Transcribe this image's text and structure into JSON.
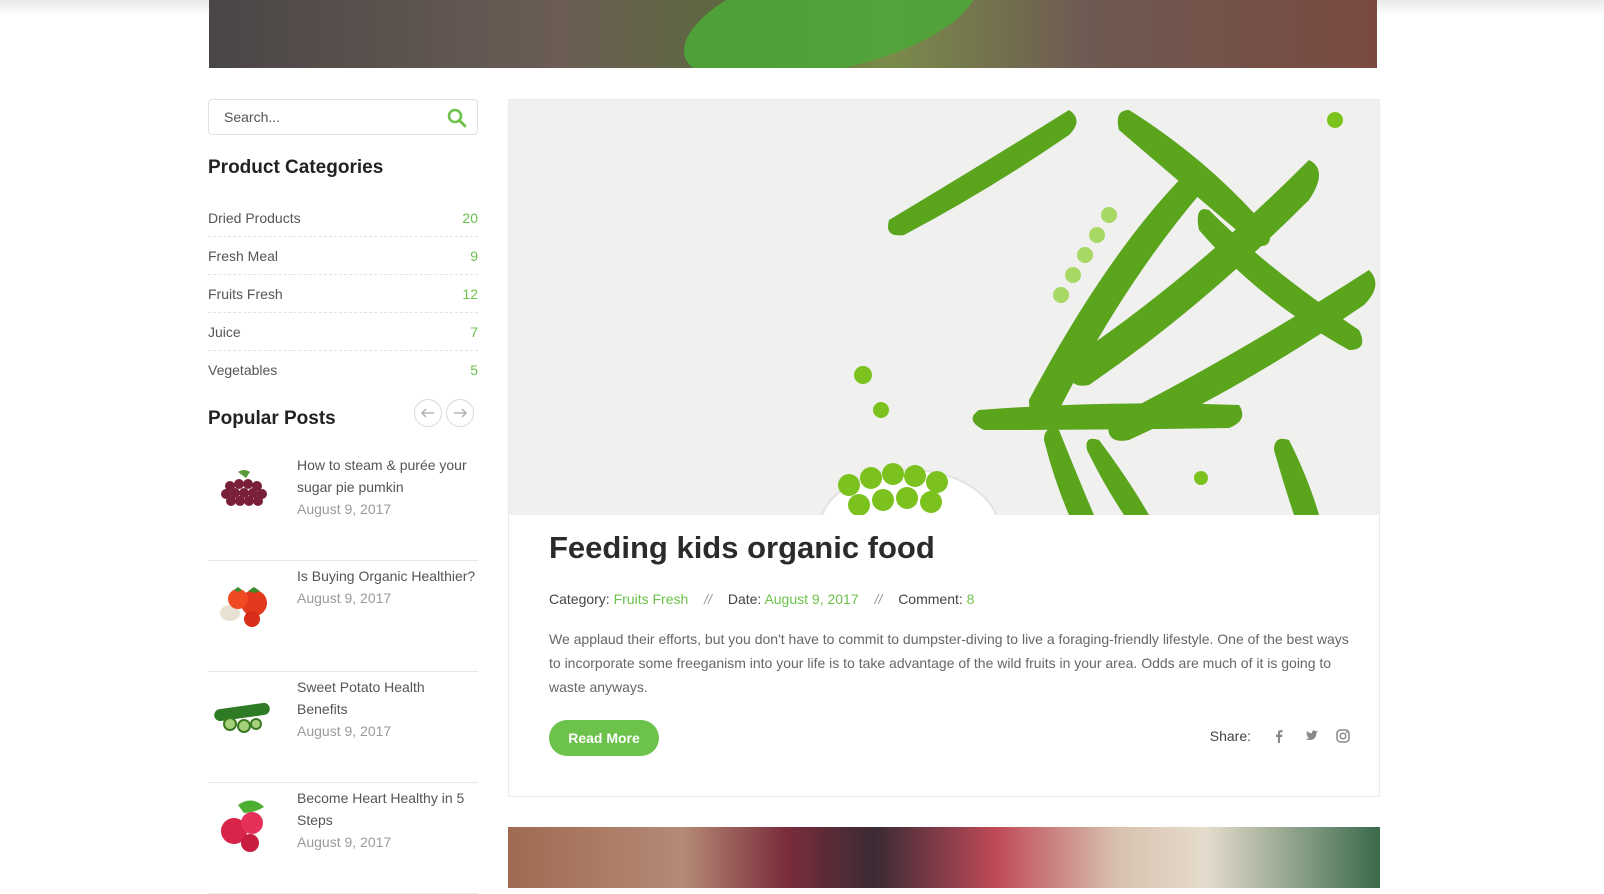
{
  "sidebar": {
    "search": {
      "placeholder": "Search...",
      "value": ""
    },
    "categories": {
      "title": "Product Categories",
      "items": [
        {
          "label": "Dried Products",
          "count": "20"
        },
        {
          "label": "Fresh Meal",
          "count": "9"
        },
        {
          "label": "Fruits Fresh",
          "count": "12"
        },
        {
          "label": "Juice",
          "count": "7"
        },
        {
          "label": "Vegetables",
          "count": "5"
        }
      ]
    },
    "popular": {
      "title": "Popular Posts",
      "prev_icon": "arrow-left-icon",
      "next_icon": "arrow-right-icon",
      "posts": [
        {
          "title": "How to steam & purée your sugar pie pumkin",
          "date": "August 9, 2017",
          "thumb": "grapes"
        },
        {
          "title": "Is Buying Organic Healthier?",
          "date": "August 9, 2017",
          "thumb": "tomatoes"
        },
        {
          "title": "Sweet Potato Health Benefits",
          "date": "August 9, 2017",
          "thumb": "cucumber"
        },
        {
          "title": "Become Heart Healthy in 5 Steps",
          "date": "August 9, 2017",
          "thumb": "raspberries"
        }
      ]
    }
  },
  "main": {
    "post": {
      "title": "Feeding kids organic food",
      "meta": {
        "category_label": "Category:",
        "category": "Fruits Fresh",
        "date_label": "Date:",
        "date": "August 9, 2017",
        "comment_label": "Comment:",
        "comments": "8",
        "separator": "//"
      },
      "excerpt": "We applaud their efforts, but you don't have to commit to dumpster-diving to live a foraging-friendly lifestyle. One of the best ways to incorporate some freeganism into your life is to take advantage of the wild fruits in your area. Odds are much of it is going to waste anyways.",
      "read_more": "Read More",
      "share_label": "Share:",
      "share_icons": [
        "facebook-icon",
        "twitter-icon",
        "instagram-icon"
      ]
    }
  },
  "colors": {
    "accent": "#6cc24a",
    "heading": "#2b2b2b",
    "muted": "#9a9a9a"
  }
}
